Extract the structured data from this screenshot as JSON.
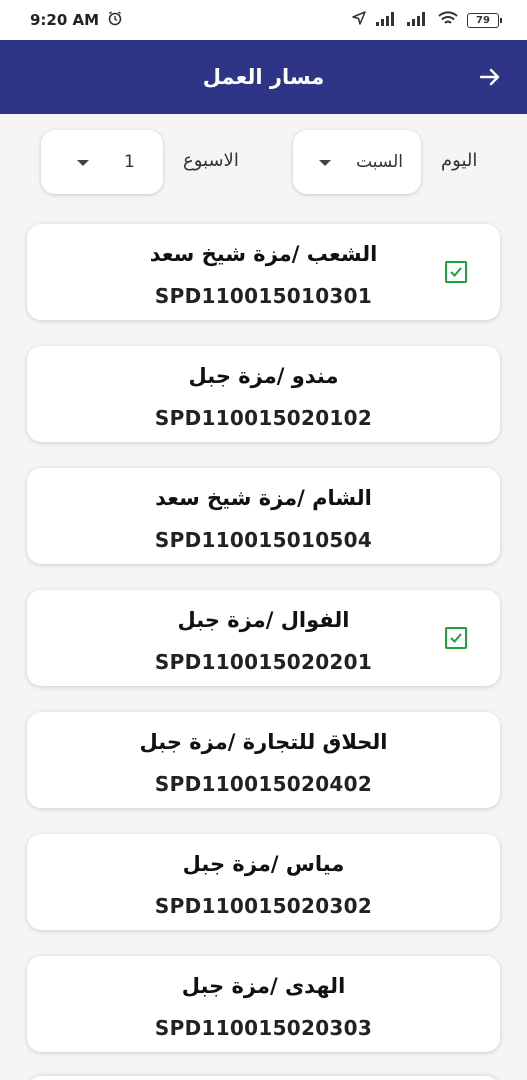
{
  "status_bar": {
    "time": "9:20 AM",
    "battery": "79"
  },
  "header": {
    "title": "مسار العمل"
  },
  "filters": {
    "day_label": "اليوم",
    "day_value": "السبت",
    "week_label": "الاسبوع",
    "week_value": "1"
  },
  "customers": [
    {
      "name": "الشعب /مزة شيخ سعد",
      "code": "SPD110015010301",
      "checked": true
    },
    {
      "name": "مندو /مزة جبل",
      "code": "SPD110015020102",
      "checked": false
    },
    {
      "name": "الشام /مزة شيخ سعد",
      "code": "SPD110015010504",
      "checked": false
    },
    {
      "name": "الفوال /مزة جبل",
      "code": "SPD110015020201",
      "checked": true
    },
    {
      "name": "الحلاق للتجارة /مزة جبل",
      "code": "SPD110015020402",
      "checked": false
    },
    {
      "name": "مياس /مزة جبل",
      "code": "SPD110015020302",
      "checked": false
    },
    {
      "name": "الهدى /مزة جبل",
      "code": "SPD110015020303",
      "checked": false
    }
  ],
  "colors": {
    "appbar": "#2e3587",
    "check": "#21a03b",
    "background": "#f5f5f5"
  }
}
